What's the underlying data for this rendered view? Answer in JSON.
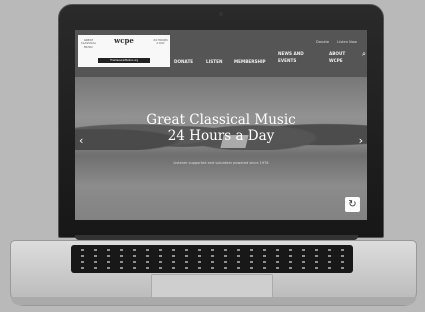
{
  "utility": {
    "donate": "Donate",
    "listen_now": "Listen Now"
  },
  "logo": {
    "left_text": "GREAT CLASSICAL MUSIC",
    "main_text": "wcpe",
    "bar_text": "TheClassicalStation.org",
    "right_text": "24 HOURS A DAY"
  },
  "nav": {
    "donate": "DONATE",
    "listen": "LISTEN",
    "membership": "MEMBERSHIP",
    "news_line1": "NEWS AND",
    "news_line2": "EVENTS",
    "about_line1": "ABOUT",
    "about_line2": "WCPE"
  },
  "hero": {
    "title_line1": "Great Classical Music",
    "title_line2": "24 Hours a Day",
    "subtitle": "Listener supported and volunteer powered since 1978"
  },
  "icons": {
    "search": "search-icon",
    "left": "chevron-left-icon",
    "right": "chevron-right-icon",
    "badge": "recaptcha-icon"
  }
}
